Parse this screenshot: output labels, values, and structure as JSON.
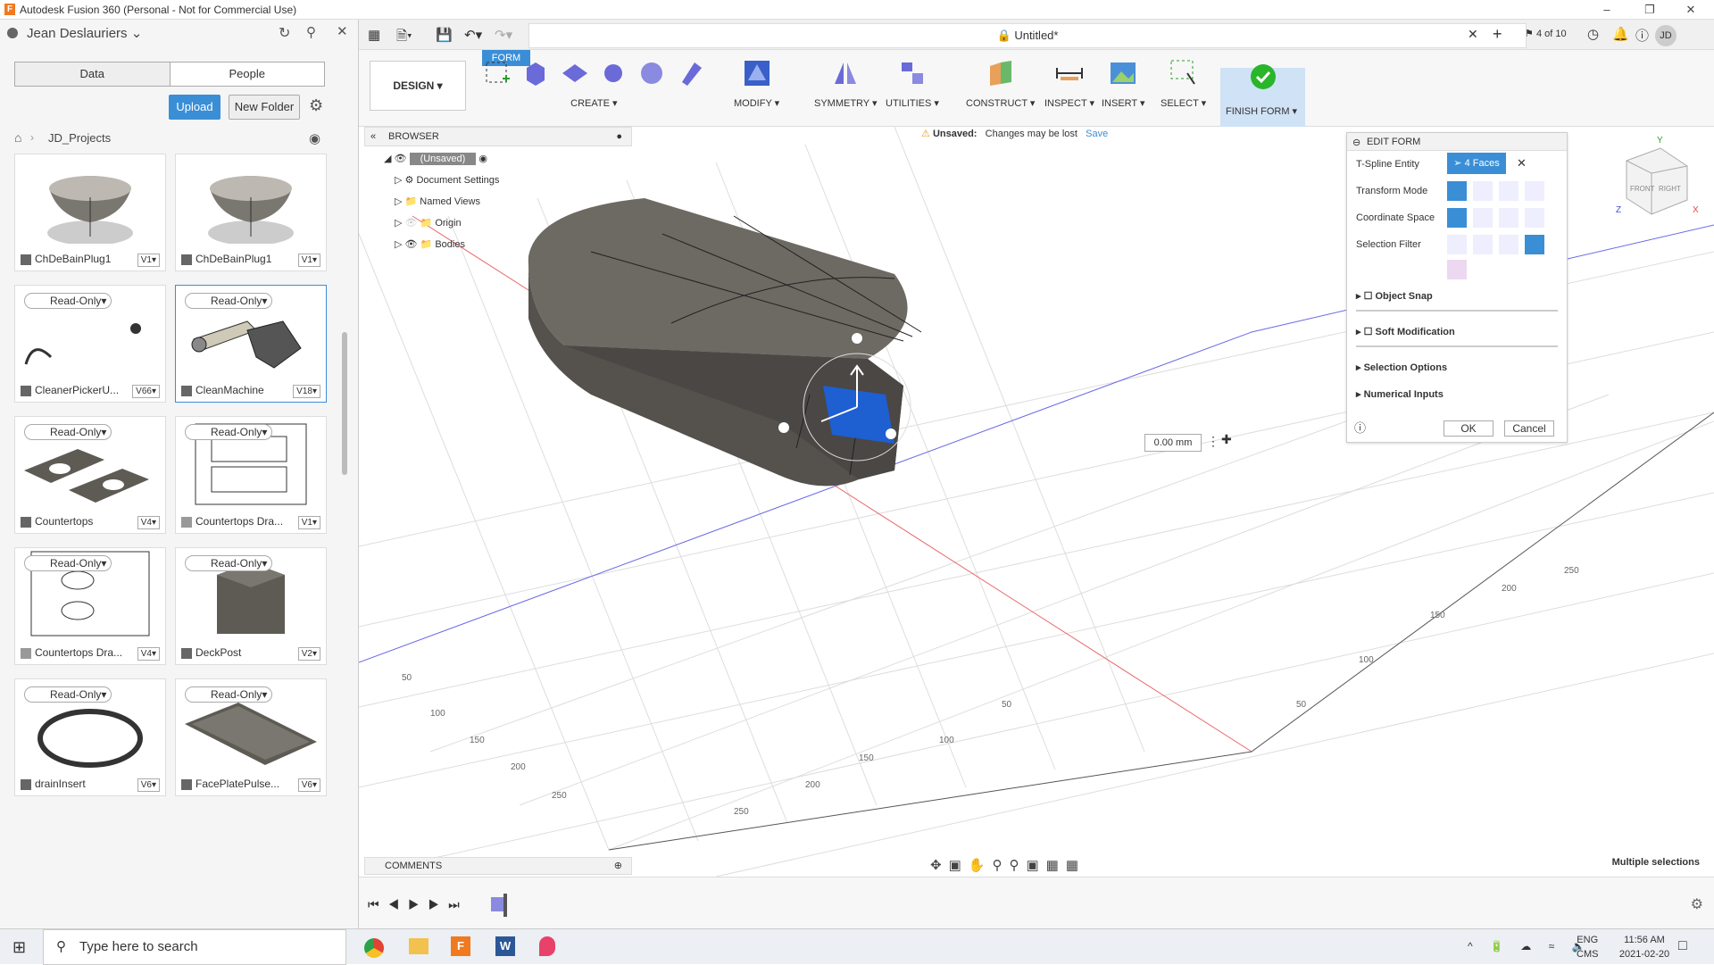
{
  "window": {
    "title": "Autodesk Fusion 360 (Personal - Not for Commercial Use)"
  },
  "datapanel": {
    "user": "Jean Deslauriers",
    "tabs": [
      "Data",
      "People"
    ],
    "upload": "Upload",
    "new_folder": "New Folder",
    "breadcrumb": "JD_Projects",
    "files": [
      {
        "name": "ChDeBainPlug1",
        "version": "V1",
        "readonly": ""
      },
      {
        "name": "ChDeBainPlug1",
        "version": "V1",
        "readonly": ""
      },
      {
        "name": "CleanerPickerU...",
        "version": "V66",
        "readonly": "Read-Only"
      },
      {
        "name": "CleanMachine",
        "version": "V18",
        "readonly": "Read-Only"
      },
      {
        "name": "Countertops",
        "version": "V4",
        "readonly": "Read-Only"
      },
      {
        "name": "Countertops Dra...",
        "version": "V1",
        "readonly": "Read-Only"
      },
      {
        "name": "Countertops Dra...",
        "version": "V4",
        "readonly": "Read-Only"
      },
      {
        "name": "DeckPost",
        "version": "V2",
        "readonly": "Read-Only"
      },
      {
        "name": "drainInsert",
        "version": "V6",
        "readonly": "Read-Only"
      },
      {
        "name": "FacePlatePulse...",
        "version": "V6",
        "readonly": "Read-Only"
      }
    ]
  },
  "toolbar": {
    "document_title": "Untitled*",
    "page_counter": "4 of 10",
    "user_initials": "JD",
    "tab_form": "FORM",
    "design": "DESIGN",
    "groups": [
      "CREATE",
      "MODIFY",
      "SYMMETRY",
      "UTILITIES",
      "CONSTRUCT",
      "INSPECT",
      "INSERT",
      "SELECT",
      "FINISH FORM"
    ]
  },
  "browser": {
    "title": "BROWSER",
    "root": "(Unsaved)",
    "items": [
      "Document Settings",
      "Named Views",
      "Origin",
      "Bodies"
    ]
  },
  "notice": {
    "label": "Unsaved:",
    "message": "Changes may be lost",
    "save": "Save"
  },
  "editform": {
    "title": "EDIT FORM",
    "tspline_entity": "T-Spline Entity",
    "faces": "4 Faces",
    "transform_mode": "Transform Mode",
    "coordinate_space": "Coordinate Space",
    "selection_filter": "Selection Filter",
    "object_snap": "Object Snap",
    "soft_modification": "Soft Modification",
    "selection_options": "Selection Options",
    "numerical_inputs": "Numerical Inputs",
    "ok": "OK",
    "cancel": "Cancel"
  },
  "viewport": {
    "dimension_value": "0.00 mm",
    "status": "Multiple selections",
    "grid_labels_right": [
      "50",
      "100",
      "150",
      "200",
      "250"
    ],
    "grid_labels_left": [
      "50",
      "100",
      "150",
      "200",
      "250"
    ],
    "grid_labels_front": [
      "50",
      "100",
      "150",
      "200",
      "250"
    ],
    "viewcube_front": "FRONT",
    "viewcube_right": "RIGHT",
    "axis_y": "Y",
    "axis_z": "Z",
    "axis_x": "X"
  },
  "comments": {
    "label": "COMMENTS"
  },
  "taskbar": {
    "search": "Type here to search",
    "lang": "ENG",
    "region": "CMS",
    "time": "11:56 AM",
    "date": "2021-02-20"
  },
  "colors": {
    "accent": "#3a8ed6",
    "selection": "#1e5fd1",
    "body": "#5e5a54"
  }
}
